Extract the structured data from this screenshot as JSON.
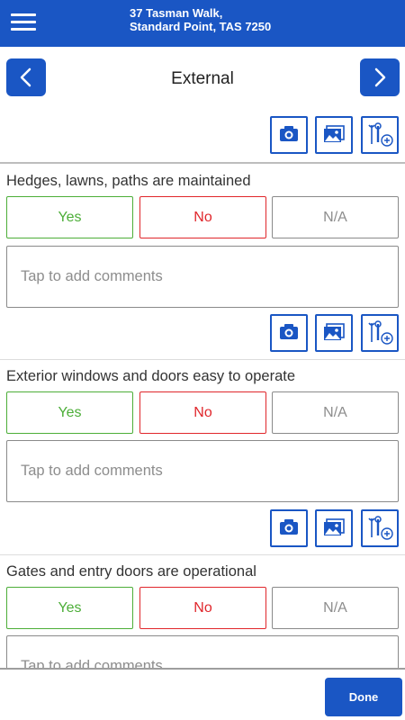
{
  "header": {
    "address_line1": "37 Tasman Walk,",
    "address_line2": "Standard Point, TAS 7250"
  },
  "section": {
    "title": "External"
  },
  "questions": [
    {
      "label": "Hedges, lawns, paths are maintained",
      "yes": "Yes",
      "no": "No",
      "na": "N/A",
      "comment_placeholder": "Tap to add comments"
    },
    {
      "label": "Exterior windows and doors easy to operate",
      "yes": "Yes",
      "no": "No",
      "na": "N/A",
      "comment_placeholder": "Tap to add comments"
    },
    {
      "label": "Gates and entry doors are operational",
      "yes": "Yes",
      "no": "No",
      "na": "N/A",
      "comment_placeholder": "Tap to add comments"
    }
  ],
  "footer": {
    "done_label": "Done"
  },
  "colors": {
    "brand_blue": "#1a56c4",
    "yes_green": "#4cae38",
    "no_red": "#e0262b",
    "na_gray": "#8d8d8d"
  },
  "icons": [
    "menu-icon",
    "chevron-left-icon",
    "chevron-right-icon",
    "camera-icon",
    "gallery-icon",
    "tools-add-icon"
  ]
}
